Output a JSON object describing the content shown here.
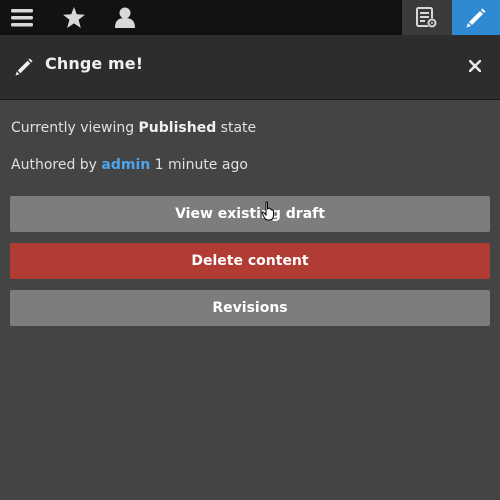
{
  "toolbar": {
    "icons": [
      "menu-icon",
      "star-icon",
      "user-icon",
      "settings-doc-icon",
      "edit-icon"
    ],
    "active_color": "#2f8ad3"
  },
  "header": {
    "title": "Chnge me!",
    "pencil_icon": "pencil-icon",
    "close_icon": "close-icon"
  },
  "status": {
    "prefix": "Currently viewing ",
    "state": "Published",
    "suffix": " state"
  },
  "author": {
    "prefix": "Authored by ",
    "name": "admin",
    "suffix": " 1 minute ago"
  },
  "buttons": {
    "view_draft": "View existing draft",
    "delete": "Delete content",
    "revisions": "Revisions"
  },
  "colors": {
    "delete": "#b03c34",
    "link": "#4fa3ec"
  }
}
